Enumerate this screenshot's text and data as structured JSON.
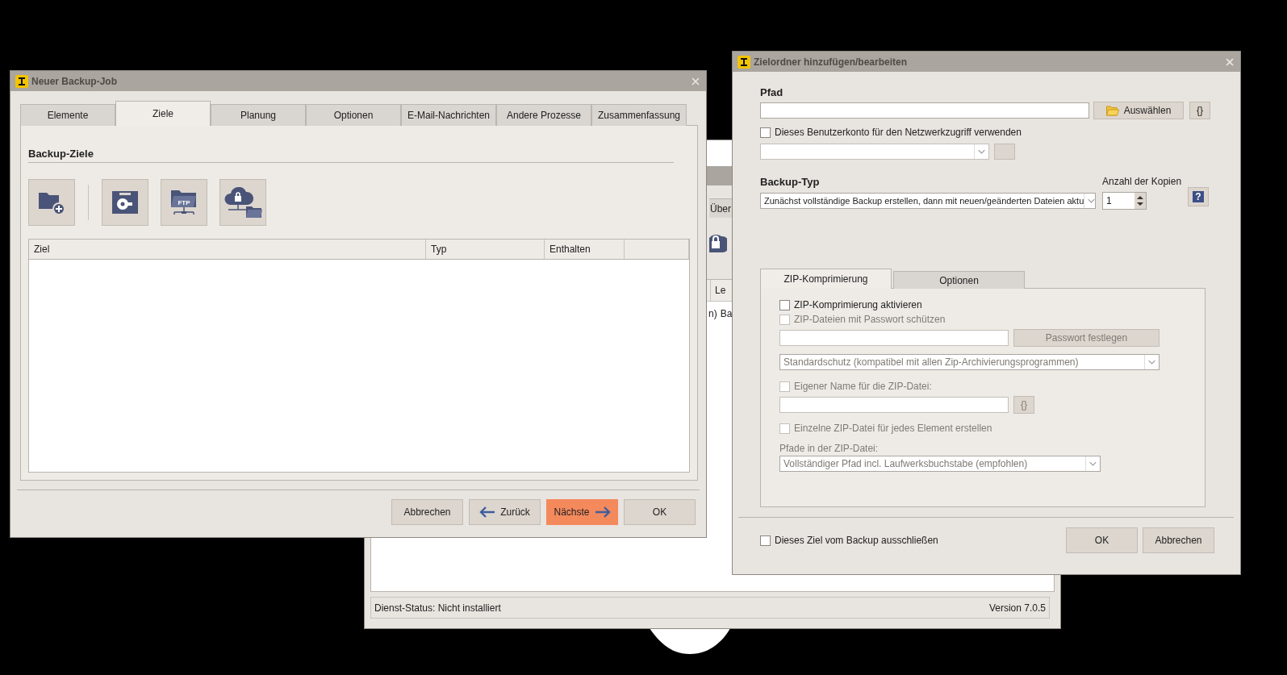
{
  "background_window": {
    "tab_fragment": "Über",
    "column_fragment": "Le",
    "row_fragments": [
      "n)",
      "Ba"
    ],
    "status": "Dienst-Status: Nicht installiert",
    "version": "Version 7.0.5"
  },
  "backup_job_window": {
    "title": "Neuer Backup-Job",
    "tabs": [
      {
        "label": "Elemente",
        "selected": false
      },
      {
        "label": "Ziele",
        "selected": true
      },
      {
        "label": "Planung",
        "selected": false
      },
      {
        "label": "Optionen",
        "selected": false
      },
      {
        "label": "E-Mail-Nachrichten",
        "selected": false
      },
      {
        "label": "Andere Prozesse",
        "selected": false
      },
      {
        "label": "Zusammenfassung",
        "selected": false
      }
    ],
    "section_title": "Backup-Ziele",
    "toolbar": [
      {
        "kind": "folder-add"
      },
      {
        "kind": "disk"
      },
      {
        "kind": "ftp",
        "label": "FTP"
      },
      {
        "kind": "cloud"
      }
    ],
    "table": {
      "columns": [
        "Ziel",
        "Typ",
        "Enthalten"
      ]
    },
    "buttons": [
      {
        "label": "Abbrechen",
        "kind": "plain"
      },
      {
        "label": "Zurück",
        "kind": "back"
      },
      {
        "label": "Nächste",
        "kind": "next"
      },
      {
        "label": "OK",
        "kind": "plain"
      }
    ]
  },
  "target_dialog": {
    "title": "Zielordner hinzufügen/bearbeiten",
    "path_label": "Pfad",
    "browse_button": "Auswählen",
    "variables_button": "{}",
    "network_account": {
      "label": "Dieses Benutzerkonto für den Netzwerkzugriff verwenden",
      "checked": false
    },
    "backup_type_label": "Backup-Typ",
    "backup_type_value": "Zunächst vollständige Backup erstellen, dann mit neuen/geänderten Dateien aktu",
    "copies_label": "Anzahl der Kopien",
    "copies_value": "1",
    "help_button": "?",
    "tabs": [
      {
        "label": "ZIP-Komprimierung",
        "selected": true
      },
      {
        "label": "Optionen",
        "selected": false
      }
    ],
    "zip_options": [
      {
        "kind": "checkbox",
        "label": "ZIP-Komprimierung aktivieren",
        "checked": false,
        "disabled": false
      },
      {
        "kind": "checkbox",
        "label": "ZIP-Dateien mit Passwort schützen",
        "checked": false,
        "disabled": true
      },
      {
        "kind": "field-button",
        "button": "Passwort festlegen",
        "disabled": true
      },
      {
        "kind": "select",
        "value": "Standardschutz (kompatibel mit allen Zip-Archivierungsprogrammen)",
        "disabled": true
      },
      {
        "kind": "checkbox",
        "label": "Eigener Name für die ZIP-Datei:",
        "checked": false,
        "disabled": true
      },
      {
        "kind": "field-button",
        "button": "{}",
        "disabled": true
      },
      {
        "kind": "checkbox",
        "label": "Einzelne ZIP-Datei für jedes Element erstellen",
        "checked": false,
        "disabled": true
      },
      {
        "kind": "label",
        "text": "Pfade in der ZIP-Datei:",
        "disabled": true
      },
      {
        "kind": "select",
        "value": "Vollständiger Pfad incl. Laufwerksbuchstabe (empfohlen)",
        "disabled": true
      }
    ],
    "exclude": {
      "label": "Dieses Ziel vom Backup ausschließen",
      "checked": false
    },
    "buttons": [
      "OK",
      "Abbrechen"
    ]
  }
}
